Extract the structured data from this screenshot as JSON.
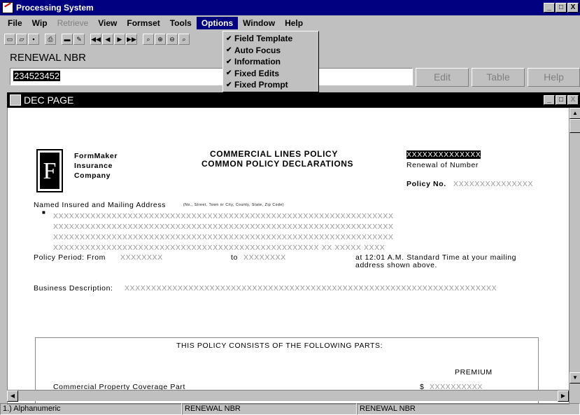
{
  "app": {
    "title": "Processing System",
    "win_buttons": [
      "_",
      "□",
      "X"
    ]
  },
  "menu": [
    {
      "label": "File",
      "state": "normal"
    },
    {
      "label": "Wip",
      "state": "normal"
    },
    {
      "label": "Retrieve",
      "state": "disabled"
    },
    {
      "label": "View",
      "state": "normal"
    },
    {
      "label": "Formset",
      "state": "normal"
    },
    {
      "label": "Tools",
      "state": "normal"
    },
    {
      "label": "Options",
      "state": "selected"
    },
    {
      "label": "Window",
      "state": "normal"
    },
    {
      "label": "Help",
      "state": "normal"
    }
  ],
  "options_menu": [
    {
      "label": "Field Template",
      "checked": true
    },
    {
      "label": "Auto Focus",
      "checked": true
    },
    {
      "label": "Information",
      "checked": true
    },
    {
      "label": "Fixed Edits",
      "checked": true
    },
    {
      "label": "Fixed Prompt",
      "checked": true
    }
  ],
  "field": {
    "label": "RENEWAL NBR",
    "value": "234523452"
  },
  "side_buttons": {
    "edit": "Edit",
    "table": "Table",
    "help": "Help"
  },
  "doc": {
    "title": "DEC PAGE",
    "company": [
      "FormMaker",
      "Insurance",
      "Company"
    ],
    "logo_letter": "F",
    "heading1": "COMMERCIAL LINES POLICY",
    "heading2": "COMMON POLICY DECLARATIONS",
    "renewal_value": "XXXXXXXXXXXXXX",
    "renewal_label": "Renewal of Number",
    "policy_label": "Policy No.",
    "policy_value": "XXXXXXXXXXXXXXX",
    "named_insured": "Named Insured and Mailing Address",
    "named_insured_note": "(No., Street, Town or City, County, State, Zip Code)",
    "addr1": "XXXXXXXXXXXXXXXXXXXXXXXXXXXXXXXXXXXXXXXXXXXXXXXXXXXXXXXXXXXXXXXX",
    "addr2": "XXXXXXXXXXXXXXXXXXXXXXXXXXXXXXXXXXXXXXXXXXXXXXXXXXXXXXXXXXXXXXXX",
    "addr3": "XXXXXXXXXXXXXXXXXXXXXXXXXXXXXXXXXXXXXXXXXXXXXXXXXXXXXXXXXXXXXXXX",
    "addr4": "XXXXXXXXXXXXXXXXXXXXXXXXXXXXXXXXXXXXXXXXXXXXXXXXXX  XX  XXXXX  XXXX",
    "period_from": "Policy Period: From",
    "from_value": "XXXXXXXX",
    "to_label": "to",
    "to_value": "XXXXXXXX",
    "time_text1": "at 12:01 A.M. Standard Time at your mailing",
    "time_text2": "address shown above.",
    "business_label": "Business Description:",
    "business_value": "XXXXXXXXXXXXXXXXXXXXXXXXXXXXXXXXXXXXXXXXXXXXXXXXXXXXXXXXXXXXXXXXXXXXXX",
    "parts_heading": "THIS POLICY CONSISTS OF THE FOLLOWING PARTS:",
    "premium": "PREMIUM",
    "part1": "Commercial Property Coverage Part",
    "part1_cur": "$",
    "part1_value": "XXXXXXXXXX"
  },
  "status": [
    "1.) Alphanumeric",
    "RENEWAL NBR",
    "RENEWAL NBR"
  ]
}
